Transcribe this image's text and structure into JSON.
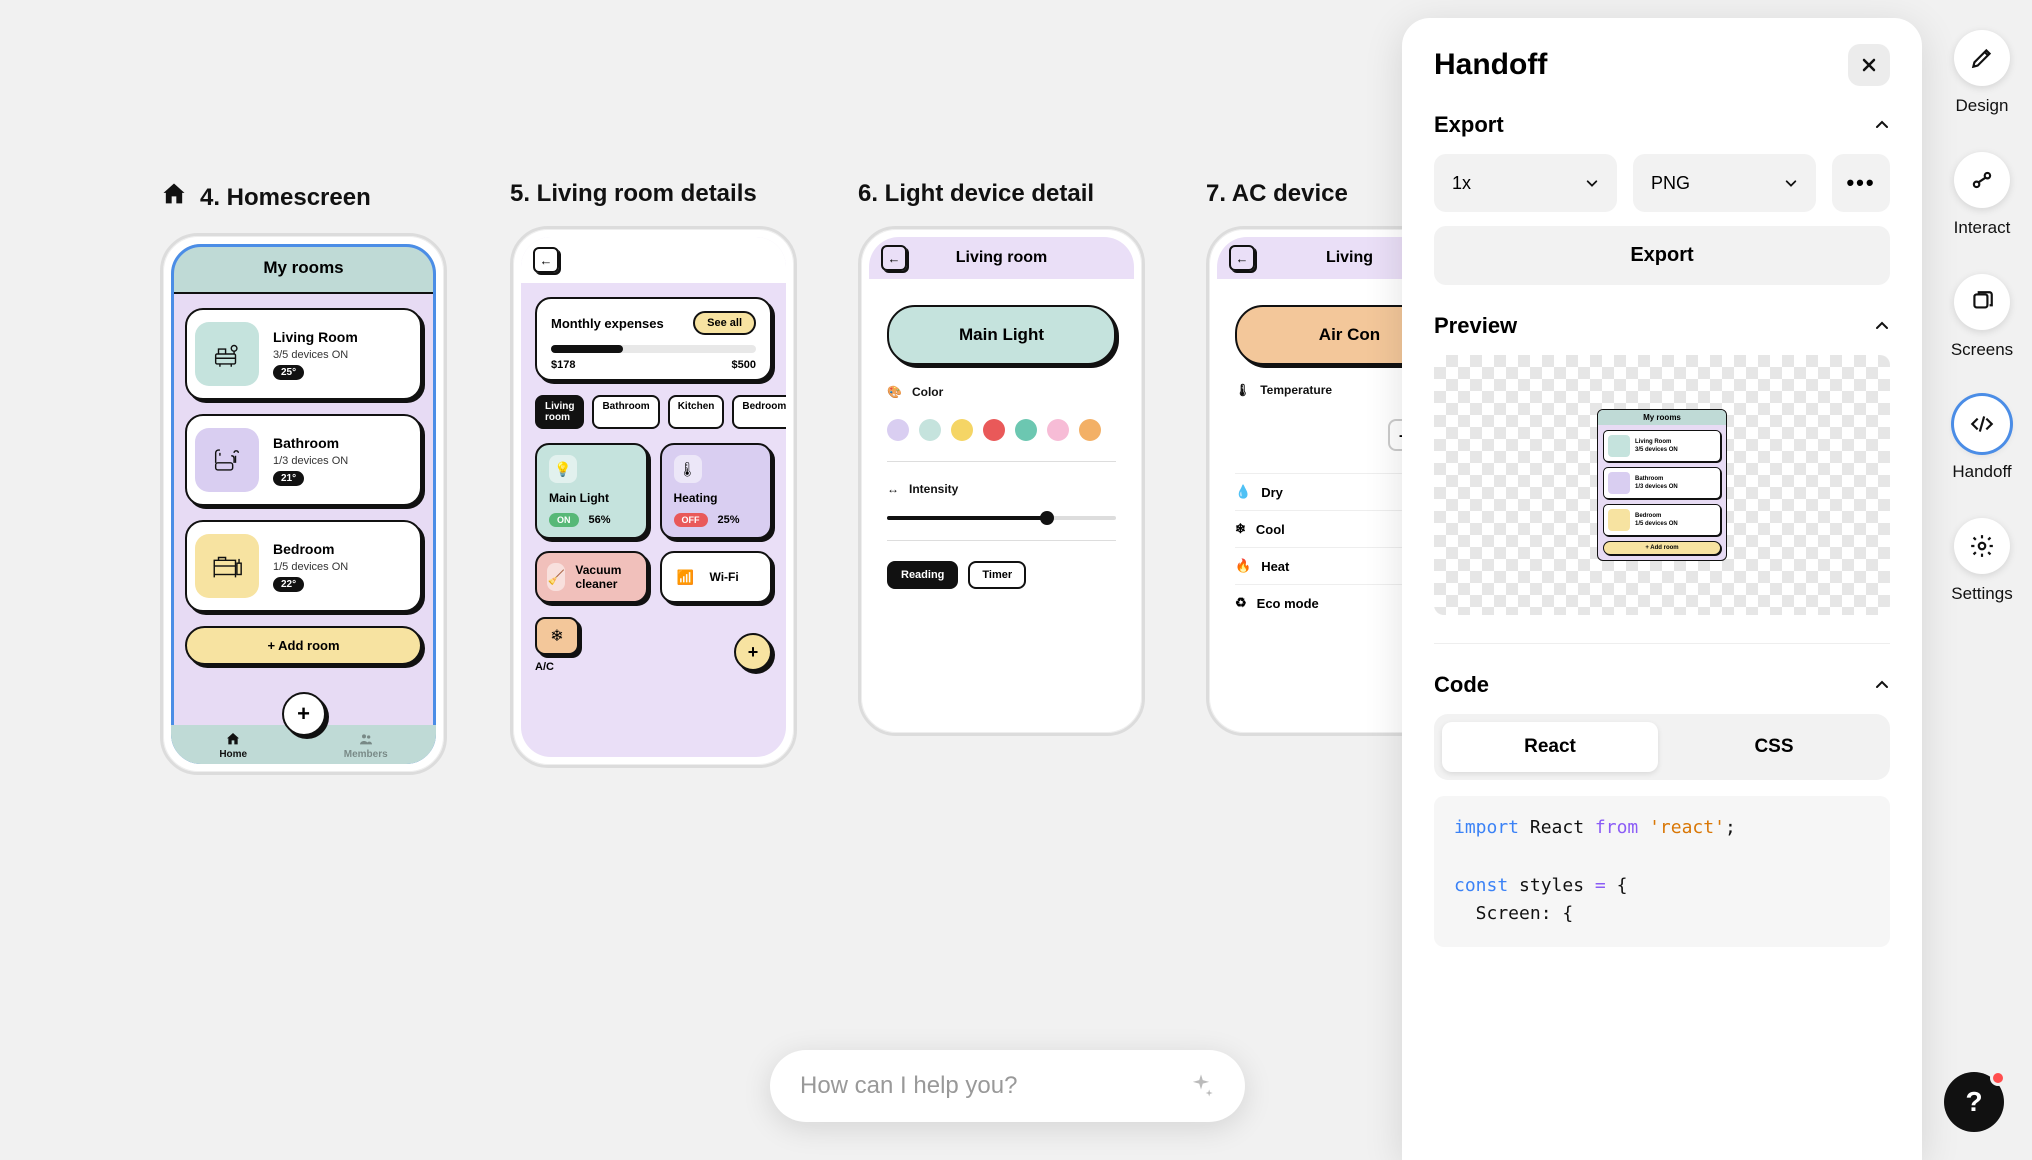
{
  "screens": [
    {
      "label": "4. Homescreen"
    },
    {
      "label": "5. Living room details"
    },
    {
      "label": "6. Light device detail"
    },
    {
      "label": "7. AC device"
    }
  ],
  "homescreen": {
    "header": "My rooms",
    "rooms": [
      {
        "name": "Living Room",
        "sub": "3/5 devices ON",
        "temp": "25°"
      },
      {
        "name": "Bathroom",
        "sub": "1/3 devices ON",
        "temp": "21°"
      },
      {
        "name": "Bedroom",
        "sub": "1/5 devices ON",
        "temp": "22°"
      }
    ],
    "add_room": "+ Add room",
    "tabs": {
      "home": "Home",
      "members": "Members"
    }
  },
  "living_room": {
    "expenses": {
      "title": "Monthly expenses",
      "see_all": "See all",
      "current": "$178",
      "max": "$500"
    },
    "tags": [
      "Living room",
      "Bathroom",
      "Kitchen",
      "Bedroom"
    ],
    "devices": {
      "main_light": {
        "name": "Main Light",
        "state": "ON",
        "pct": "56%"
      },
      "heating": {
        "name": "Heating",
        "state": "OFF",
        "pct": "25%"
      },
      "vacuum": {
        "name": "Vacuum cleaner"
      },
      "wifi": {
        "name": "Wi-Fi"
      },
      "ac": {
        "name": "A/C"
      }
    }
  },
  "light_detail": {
    "title": "Living room",
    "button": "Main Light",
    "color_label": "Color",
    "colors": [
      "#d9cef1",
      "#c5e3dd",
      "#f5d565",
      "#e95959",
      "#6cc7b1",
      "#f7bcd6",
      "#f3b066"
    ],
    "intensity_label": "Intensity",
    "modes": [
      "Reading",
      "Timer"
    ]
  },
  "ac_detail": {
    "title": "Living",
    "button": "Air Con",
    "temp_label": "Temperature",
    "temp_visible": "2",
    "modes": [
      "Dry",
      "Cool",
      "Heat",
      "Eco mode"
    ]
  },
  "panel": {
    "title": "Handoff",
    "export": {
      "title": "Export",
      "scale": "1x",
      "format": "PNG",
      "button": "Export"
    },
    "preview": {
      "title": "Preview"
    },
    "code": {
      "title": "Code",
      "tabs": [
        "React",
        "CSS"
      ],
      "line1_kw": "import",
      "line1_plain": " React ",
      "line1_kw2": "from",
      "line1_str": " 'react'",
      "line1_end": ";",
      "line2_kw": "const",
      "line2_plain": " styles ",
      "line2_op": "=",
      "line2_brace": " {",
      "line3": "  Screen: {"
    }
  },
  "rail": [
    "Design",
    "Interact",
    "Screens",
    "Handoff",
    "Settings"
  ],
  "prompt": {
    "placeholder": "How can I help you?"
  },
  "help": "?"
}
